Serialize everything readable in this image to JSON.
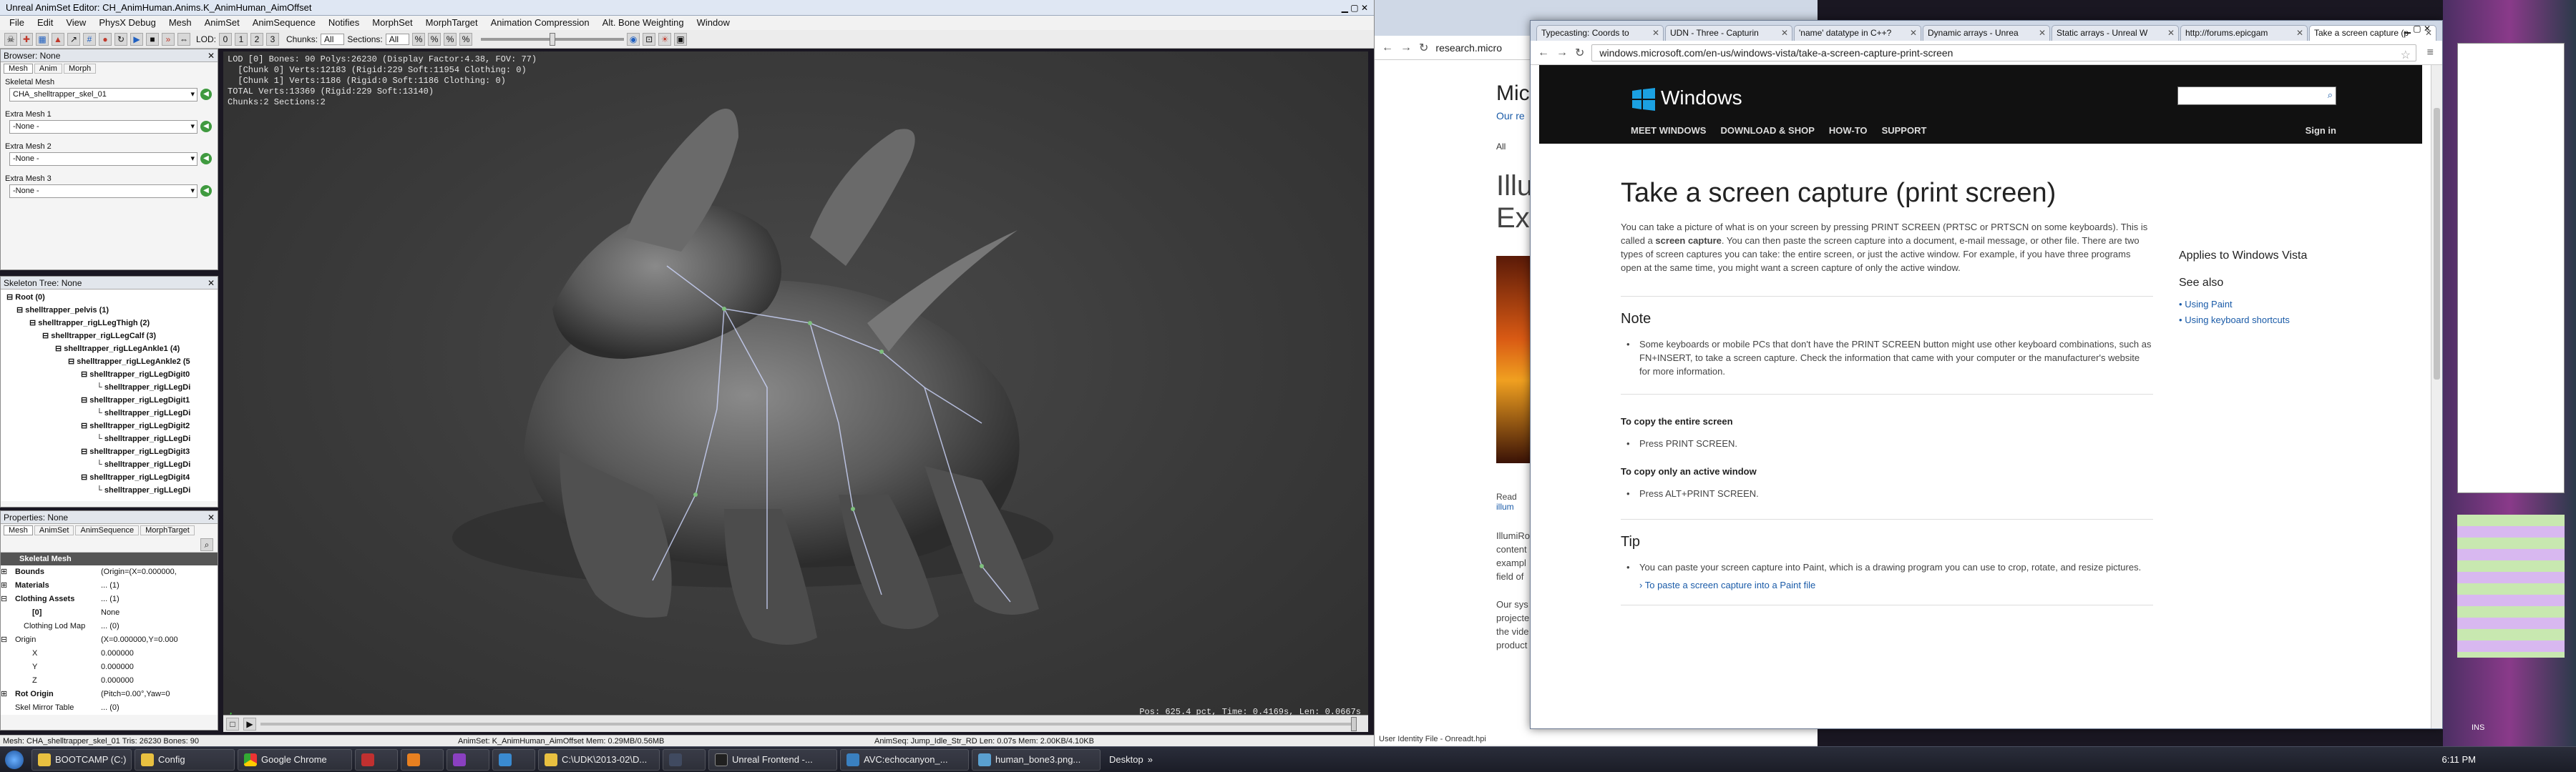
{
  "unreal": {
    "title": "Unreal AnimSet Editor: CH_AnimHuman.Anims.K_AnimHuman_AimOffset",
    "menu": [
      "File",
      "Edit",
      "View",
      "PhysX Debug",
      "Mesh",
      "AnimSet",
      "AnimSequence",
      "Notifies",
      "MorphSet",
      "MorphTarget",
      "Animation Compression",
      "Alt. Bone Weighting",
      "Window"
    ],
    "toolbar": {
      "lod_label": "LOD:",
      "chunks_label": "Chunks:",
      "chunks_value": "All",
      "sections_label": "Sections:",
      "sections_value": "All"
    },
    "browser": {
      "title": "Browser: None",
      "tabs": [
        "Mesh",
        "Anim",
        "Morph"
      ],
      "skeletal_mesh_label": "Skeletal Mesh",
      "skeletal_mesh_value": "CHA_shelltrapper_skel_01",
      "extra1_label": "Extra Mesh 1",
      "extra2_label": "Extra Mesh 2",
      "extra3_label": "Extra Mesh 3",
      "none_value": "-None -"
    },
    "skeleton_tree": {
      "title": "Skeleton Tree: None",
      "nodes": [
        "Root (0)",
        "shelltrapper_pelvis (1)",
        "shelltrapper_rigLLegThigh (2)",
        "shelltrapper_rigLLegCalf (3)",
        "shelltrapper_rigLLegAnkle1 (4)",
        "shelltrapper_rigLLegAnkle2 (5",
        "shelltrapper_rigLLegDigit0",
        "shelltrapper_rigLLegDi",
        "shelltrapper_rigLLegDigit1",
        "shelltrapper_rigLLegDi",
        "shelltrapper_rigLLegDigit2",
        "shelltrapper_rigLLegDi",
        "shelltrapper_rigLLegDigit3",
        "shelltrapper_rigLLegDi",
        "shelltrapper_rigLLegDigit4",
        "shelltrapper_rigLLegDi"
      ]
    },
    "properties": {
      "title": "Properties: None",
      "tabs": [
        "Mesh",
        "AnimSet",
        "AnimSequence",
        "MorphTarget"
      ],
      "header": "Skeletal Mesh",
      "rows": [
        {
          "name": "Bounds",
          "value": "(Origin=(X=0.000000,"
        },
        {
          "name": "Materials",
          "value": "... (1)"
        },
        {
          "name": "Clothing Assets",
          "value": "... (1)"
        },
        {
          "name": "[0]",
          "value": "None"
        },
        {
          "name": "Clothing Lod Map",
          "value": "... (0)"
        },
        {
          "name": "Origin",
          "value": "(X=0.000000,Y=0.000"
        },
        {
          "name": "X",
          "value": "0.000000"
        },
        {
          "name": "Y",
          "value": "0.000000"
        },
        {
          "name": "Z",
          "value": "0.000000"
        },
        {
          "name": "Rot Origin",
          "value": "(Pitch=0.00°,Yaw=0"
        },
        {
          "name": "Skel Mirror Table",
          "value": "... (0)"
        }
      ]
    },
    "viewport_info": [
      "LOD [0] Bones: 90 Polys:26230 (Display Factor:4.38, FOV: 77)",
      "  [Chunk 0] Verts:12183 (Rigid:229 Soft:11954 Clothing: 0)",
      "  [Chunk 1] Verts:1186 (Rigid:0 Soft:1186 Clothing: 0)",
      "TOTAL Verts:13369 (Rigid:229 Soft:13140)",
      "Chunks:2 Sections:2"
    ],
    "viewport_pos": "Pos: 625.4 pct, Time: 0.4169s, Len: 0.0667s",
    "status_left": "Mesh: CHA_shelltrapper_skel_01  Tris: 26230  Bones: 90",
    "status_mid": "AnimSet: K_AnimHuman_AimOffset  Mem: 0.29MB/0.56MB",
    "status_right": "AnimSeq: Jump_Idle_Str_RD  Len: 0.07s  Mem: 2.00KB/4.10KB"
  },
  "back_browser": {
    "address": "research.micro",
    "brand": "Micr",
    "sub_link": "Our re",
    "filter": "All",
    "heading": "Illu",
    "heading2": "Exp",
    "read_more": "Read",
    "read_more_link": "illum",
    "para1": [
      "IllumiRo",
      "content",
      "exampl",
      "field of"
    ],
    "para2": [
      "Our sys",
      "projecte",
      "the vide",
      "product"
    ],
    "bottom": "User Identity File - Onreadt.hpi"
  },
  "front_browser": {
    "tabs": [
      {
        "label": "Typecasting: Coords to",
        "active": false
      },
      {
        "label": "UDN - Three - Capturin",
        "active": false
      },
      {
        "label": "'name' datatype in C++?",
        "active": false
      },
      {
        "label": "Dynamic arrays - Unrea",
        "active": false
      },
      {
        "label": "Static arrays - Unreal W",
        "active": false
      },
      {
        "label": "http://forums.epicgam",
        "active": false
      },
      {
        "label": "Take a screen capture (p",
        "active": true
      }
    ],
    "url": "windows.microsoft.com/en-us/windows-vista/take-a-screen-capture-print-screen",
    "brand": "Windows",
    "nav": [
      "MEET WINDOWS",
      "DOWNLOAD & SHOP",
      "HOW-TO",
      "SUPPORT"
    ],
    "sign_in": "Sign in",
    "page_title": "Take a screen capture (print screen)",
    "intro_1": "You can take a picture of what is on your screen by pressing PRINT SCREEN (PRTSC or PRTSCN on some keyboards). This is",
    "intro_2a": "called a ",
    "intro_2b": "screen capture",
    "intro_2c": ". You can then paste the screen capture into a document, e-mail message, or other file. There are two",
    "intro_3": "types of screen captures you can take: the entire screen, or just the active window. For example, if you have three programs",
    "intro_4": "open at the same time, you might want a screen capture of only the active window.",
    "note_heading": "Note",
    "note_1": "Some keyboards or mobile PCs that don't have the PRINT SCREEN button might use other keyboard combinations, such as",
    "note_2": "FN+INSERT, to take a screen capture. Check the information that came with your computer or the manufacturer's website",
    "note_3": "for more information.",
    "copy_entire_heading": "To copy the entire screen",
    "copy_entire_step": "Press PRINT SCREEN.",
    "copy_active_heading": "To copy only an active window",
    "copy_active_step": "Press ALT+PRINT SCREEN.",
    "tip_heading": "Tip",
    "tip_text": "You can paste your screen capture into Paint, which is a drawing program you can use to crop, rotate, and resize pictures.",
    "tip_link": "To paste a screen capture into a Paint file",
    "applies_to": "Applies to Windows Vista",
    "see_also": "See also",
    "see_also_links": [
      "Using Paint",
      "Using keyboard shortcuts"
    ]
  },
  "taskbar": {
    "items": [
      "BOOTCAMP (C:)",
      "Config",
      "Google Chrome",
      "",
      "",
      "",
      "",
      "C:\\UDK\\2013-02\\D...",
      "",
      "Unreal Frontend -...",
      "AVC:echocanyon_...",
      "human_bone3.png...",
      "Desktop"
    ],
    "clock": "6:11 PM",
    "ins": "INS"
  }
}
